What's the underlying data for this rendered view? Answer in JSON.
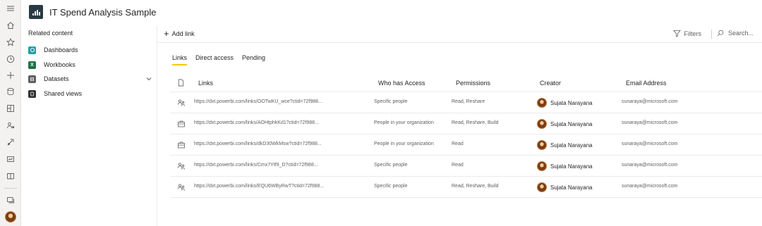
{
  "header": {
    "title": "IT Spend Analysis Sample"
  },
  "related": {
    "title": "Related content",
    "items": [
      {
        "label": "Dashboards",
        "icon": "dashboard-icon",
        "color": "#1aa3a3"
      },
      {
        "label": "Workbooks",
        "icon": "excel-workbook-icon",
        "color": "#1e7145"
      },
      {
        "label": "Datasets",
        "icon": "dataset-icon",
        "color": "#605e5c"
      },
      {
        "label": "Shared views",
        "icon": "shared-view-icon",
        "color": "#323130"
      }
    ]
  },
  "cmdbar": {
    "add_link": "Add link",
    "filters": "Filters",
    "search": "Search..."
  },
  "tabs": [
    {
      "label": "Links"
    },
    {
      "label": "Direct access"
    },
    {
      "label": "Pending"
    }
  ],
  "table": {
    "headers": [
      "Links",
      "Who has Access",
      "Permissions",
      "Creator",
      "Email Address"
    ],
    "rows": [
      {
        "icon": "people-link-icon",
        "link": "https://dxt.powerbi.com/links/OOTwKU_wce?ctid=72f988...",
        "access": "Specific people",
        "permissions": "Read, Reshare",
        "creator": "Sujata Narayana",
        "email": "sunaraya@microsoft.com"
      },
      {
        "icon": "organization-icon",
        "link": "https://dxt.powerbi.com/links/AOHtphkKd1?ctid=72f988...",
        "access": "People in your organization",
        "permissions": "Read, Reshare, Build",
        "creator": "Sujata Narayana",
        "email": "sunaraya@microsoft.com"
      },
      {
        "icon": "organization-icon",
        "link": "https://dxt.powerbi.com/links/dkD30WkMsw?ctid=72f988...",
        "access": "People in your organization",
        "permissions": "Read",
        "creator": "Sujata Narayana",
        "email": "sunaraya@microsoft.com"
      },
      {
        "icon": "people-link-icon",
        "link": "https://dxt.powerbi.com/links/Cmx7Ytf9_D?ctid=72f988...",
        "access": "Specific people",
        "permissions": "Read",
        "creator": "Sujata Narayana",
        "email": "sunaraya@microsoft.com"
      },
      {
        "icon": "people-link-icon",
        "link": "https://dxt.powerbi.com/links/EQU6WByRwT?ctid=72f988...",
        "access": "Specific people",
        "permissions": "Read, Reshare, Build",
        "creator": "Sujata Narayana",
        "email": "sunaraya@microsoft.com"
      }
    ]
  },
  "colors": {
    "tab_accent": "#f2c811",
    "rail_bg": "#f3f2f1",
    "logo_bg": "#2b3b45"
  },
  "rail_icons": [
    "hamburger-icon",
    "home-icon",
    "favorites-icon",
    "recent-icon",
    "create-icon",
    "datasets-icon",
    "apps-icon",
    "shared-icon",
    "deployment-icon",
    "metrics-icon",
    "learn-icon",
    "workspaces-icon",
    "profile-avatar"
  ]
}
